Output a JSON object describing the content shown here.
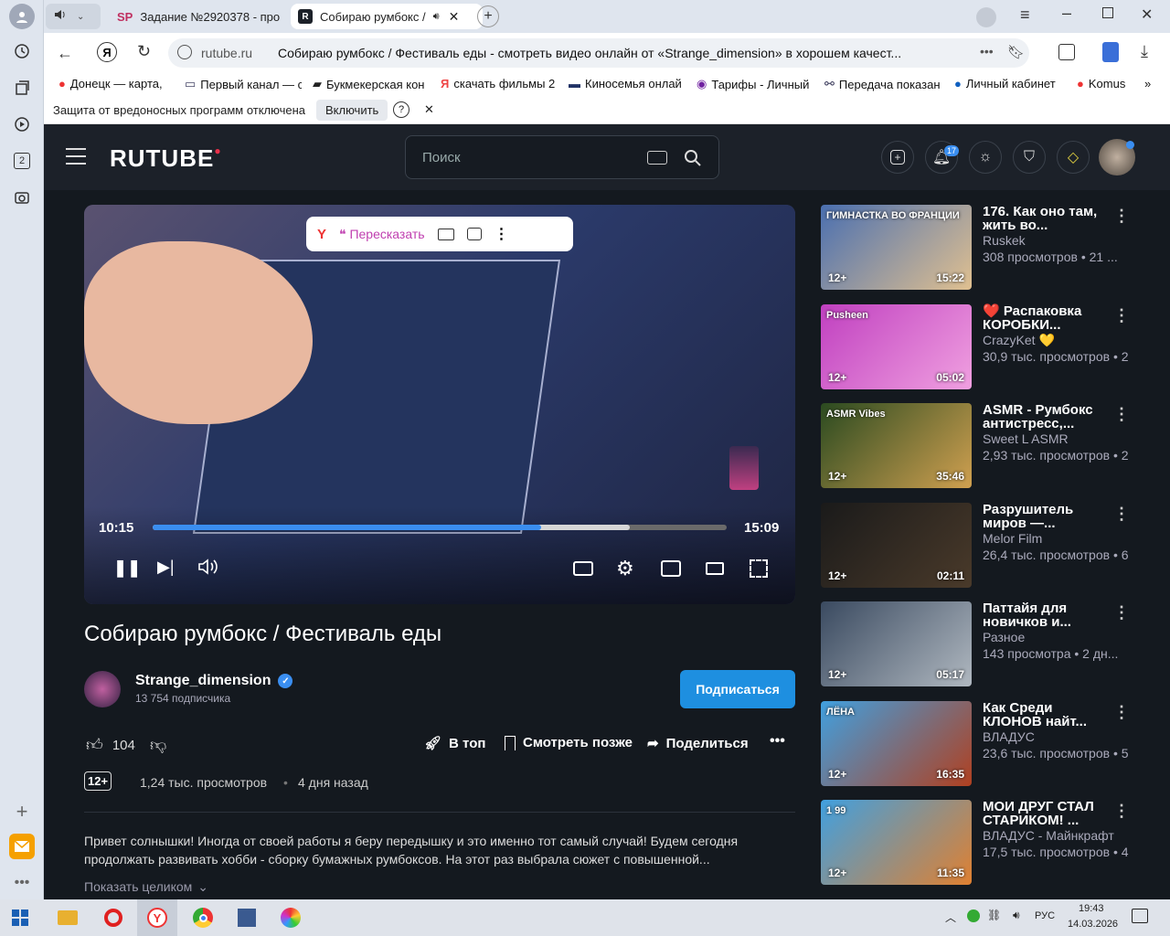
{
  "browser": {
    "tabs": [
      {
        "label": "Задание №2920378 - про"
      },
      {
        "label": "Собираю румбокс /"
      }
    ],
    "address": {
      "domain": "rutube.ru",
      "title": "Собираю румбокс / Фестиваль еды - смотреть видео онлайн от «Strange_dimension» в хорошем качест..."
    },
    "bookmarks": [
      "Донецк — карта,",
      "Первый канал — с",
      "Букмекерская кон",
      "скачать фильмы 2",
      "Киносемья онлай",
      "Тарифы - Личный",
      "Передача показан",
      "Личный кабинет",
      "Komus"
    ],
    "warning": {
      "text": "Защита от вредоносных программ отключена",
      "button": "Включить"
    },
    "sidebar_badge": "2"
  },
  "rutube": {
    "logo": "RUTUBE",
    "search_placeholder": "Поиск",
    "notif_count": "17"
  },
  "player": {
    "retell_label": "Пересказать",
    "current_time": "10:15",
    "duration": "15:09",
    "progress": 0.676,
    "buffered": 0.831
  },
  "video": {
    "title": "Собираю румбокс / Фестиваль еды",
    "channel": "Strange_dimension",
    "subscribers": "13 754 подписчика",
    "subscribe_label": "Подписаться",
    "likes": "104",
    "to_top": "В топ",
    "watch_later": "Смотреть позже",
    "share": "Поделиться",
    "age": "12+",
    "views": "1,24 тыс. просмотров",
    "date": "4 дня назад",
    "description": "Привет солнышки! Иногда от своей работы я беру передышку и это именно тот самый случай! Будем сегодня продолжать развивать хобби - сборку бумажных румбоксов. На этот раз выбрала сюжет с повышенной...",
    "show_more": "Показать целиком"
  },
  "recommendations": [
    {
      "title": "176. Как оно там, жить во...",
      "channel": "Ruskek",
      "meta": "308 просмотров • 21 ...",
      "age": "12+",
      "duration": "15:22",
      "thumb_text": "ГИМНАСТКА ВО ФРАНЦИИ",
      "color1": "#4a6fb0",
      "color2": "#e0c090"
    },
    {
      "title": "❤️ Распаковка КОРОБКИ...",
      "channel": "CrazyKet 💛",
      "meta": "30,9 тыс. просмотров • 2",
      "age": "12+",
      "duration": "05:02",
      "thumb_text": "Pusheen",
      "color1": "#c040c0",
      "color2": "#f0a0e0"
    },
    {
      "title": "ASMR - Румбокс антистресс,...",
      "channel": "Sweet L ASMR",
      "meta": "2,93 тыс. просмотров • 2",
      "age": "12+",
      "duration": "35:46",
      "thumb_text": "ASMR Vibes",
      "color1": "#2a4a20",
      "color2": "#d0a050"
    },
    {
      "title": "Разрушитель миров —...",
      "channel": "Melor Film",
      "meta": "26,4 тыс. просмотров • 6",
      "age": "12+",
      "duration": "02:11",
      "thumb_text": "",
      "color1": "#1a1a1a",
      "color2": "#4a3a2a"
    },
    {
      "title": "Паттайя для новичков и...",
      "channel": "Разное",
      "meta": "143 просмотра • 2 дн...",
      "age": "12+",
      "duration": "05:17",
      "thumb_text": "",
      "color1": "#3a4a60",
      "color2": "#b0b8c0"
    },
    {
      "title": "Как Среди КЛОНОВ найт...",
      "channel": "ВЛАДУС",
      "meta": "23,6 тыс. просмотров • 5",
      "age": "12+",
      "duration": "16:35",
      "thumb_text": "ЛЁНА",
      "color1": "#40a0e0",
      "color2": "#b04020"
    },
    {
      "title": "МОИ ДРУГ СТАЛ СТАРИКОМ! ...",
      "channel": "ВЛАДУС - Майнкрафт",
      "meta": "17,5 тыс. просмотров • 4",
      "age": "12+",
      "duration": "11:35",
      "thumb_text": "1 99",
      "color1": "#40a0e0",
      "color2": "#e08030"
    }
  ],
  "taskbar": {
    "lang": "РУС",
    "time": "19:43",
    "date": "14.03.2026"
  }
}
